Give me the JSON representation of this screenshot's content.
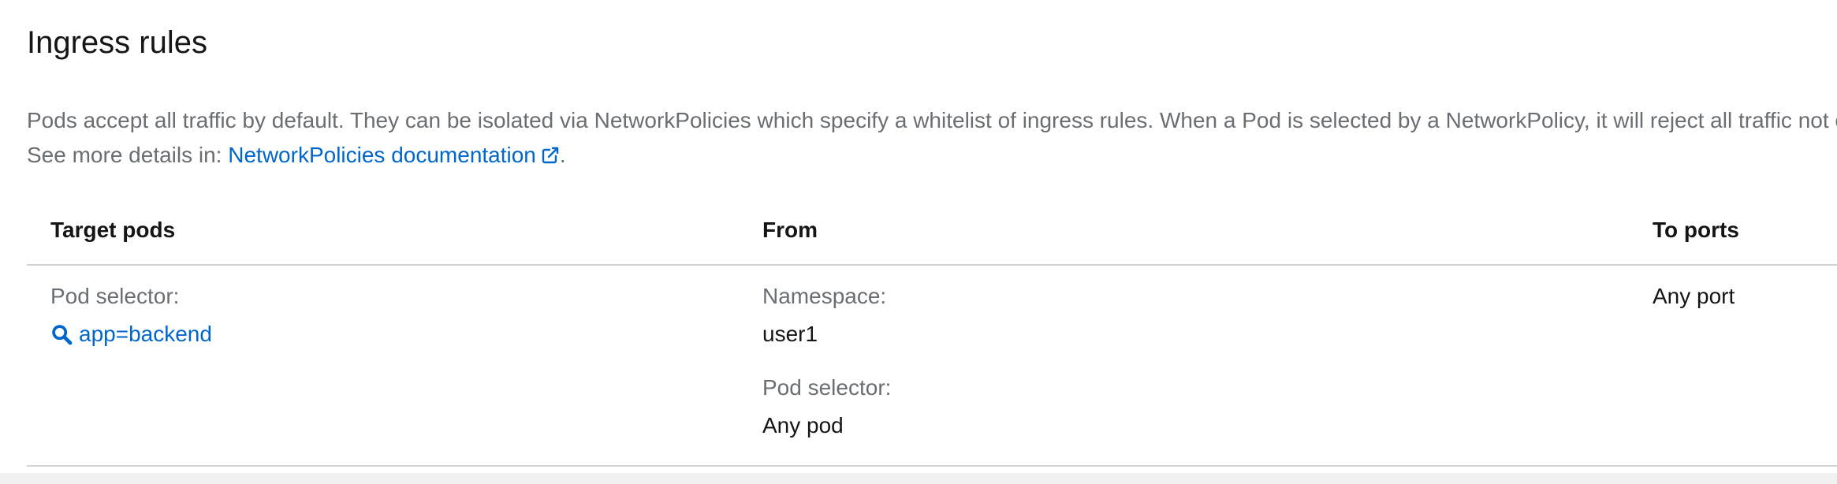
{
  "section": {
    "title": "Ingress rules"
  },
  "description": {
    "line1": "Pods accept all traffic by default. They can be isolated via NetworkPolicies which specify a whitelist of ingress rules. When a Pod is selected by a NetworkPolicy, it will reject all traffic not e",
    "prefix": "See more details in: ",
    "link_label": "NetworkPolicies documentation",
    "suffix": "."
  },
  "table": {
    "headers": {
      "target_pods": "Target pods",
      "from": "From",
      "to_ports": "To ports"
    },
    "rows": [
      {
        "target": {
          "label": "Pod selector:",
          "selector": "app=backend"
        },
        "from": {
          "namespace_label": "Namespace:",
          "namespace_value": "user1",
          "pod_selector_label": "Pod selector:",
          "pod_selector_value": "Any pod"
        },
        "ports": "Any port"
      }
    ]
  },
  "icons": {
    "external_link": "external-link-icon",
    "search": "search-icon"
  },
  "colors": {
    "link": "#0066cc",
    "muted_text": "#6a6e73",
    "text": "#151515",
    "border": "#d2d2d2"
  }
}
